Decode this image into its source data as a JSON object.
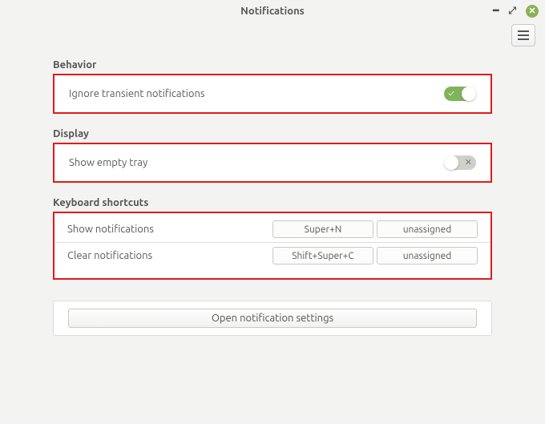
{
  "window": {
    "title": "Notifications"
  },
  "sections": {
    "behavior": {
      "title": "Behavior",
      "ignore_transient": {
        "label": "Ignore transient notifications",
        "state": "on"
      }
    },
    "display": {
      "title": "Display",
      "show_empty_tray": {
        "label": "Show empty tray",
        "state": "off"
      }
    },
    "shortcuts": {
      "title": "Keyboard shortcuts",
      "rows": [
        {
          "label": "Show notifications",
          "binding1": "Super+N",
          "binding2": "unassigned"
        },
        {
          "label": "Clear notifications",
          "binding1": "Shift+Super+C",
          "binding2": "unassigned"
        }
      ]
    }
  },
  "footer": {
    "open_settings": "Open notification settings"
  }
}
